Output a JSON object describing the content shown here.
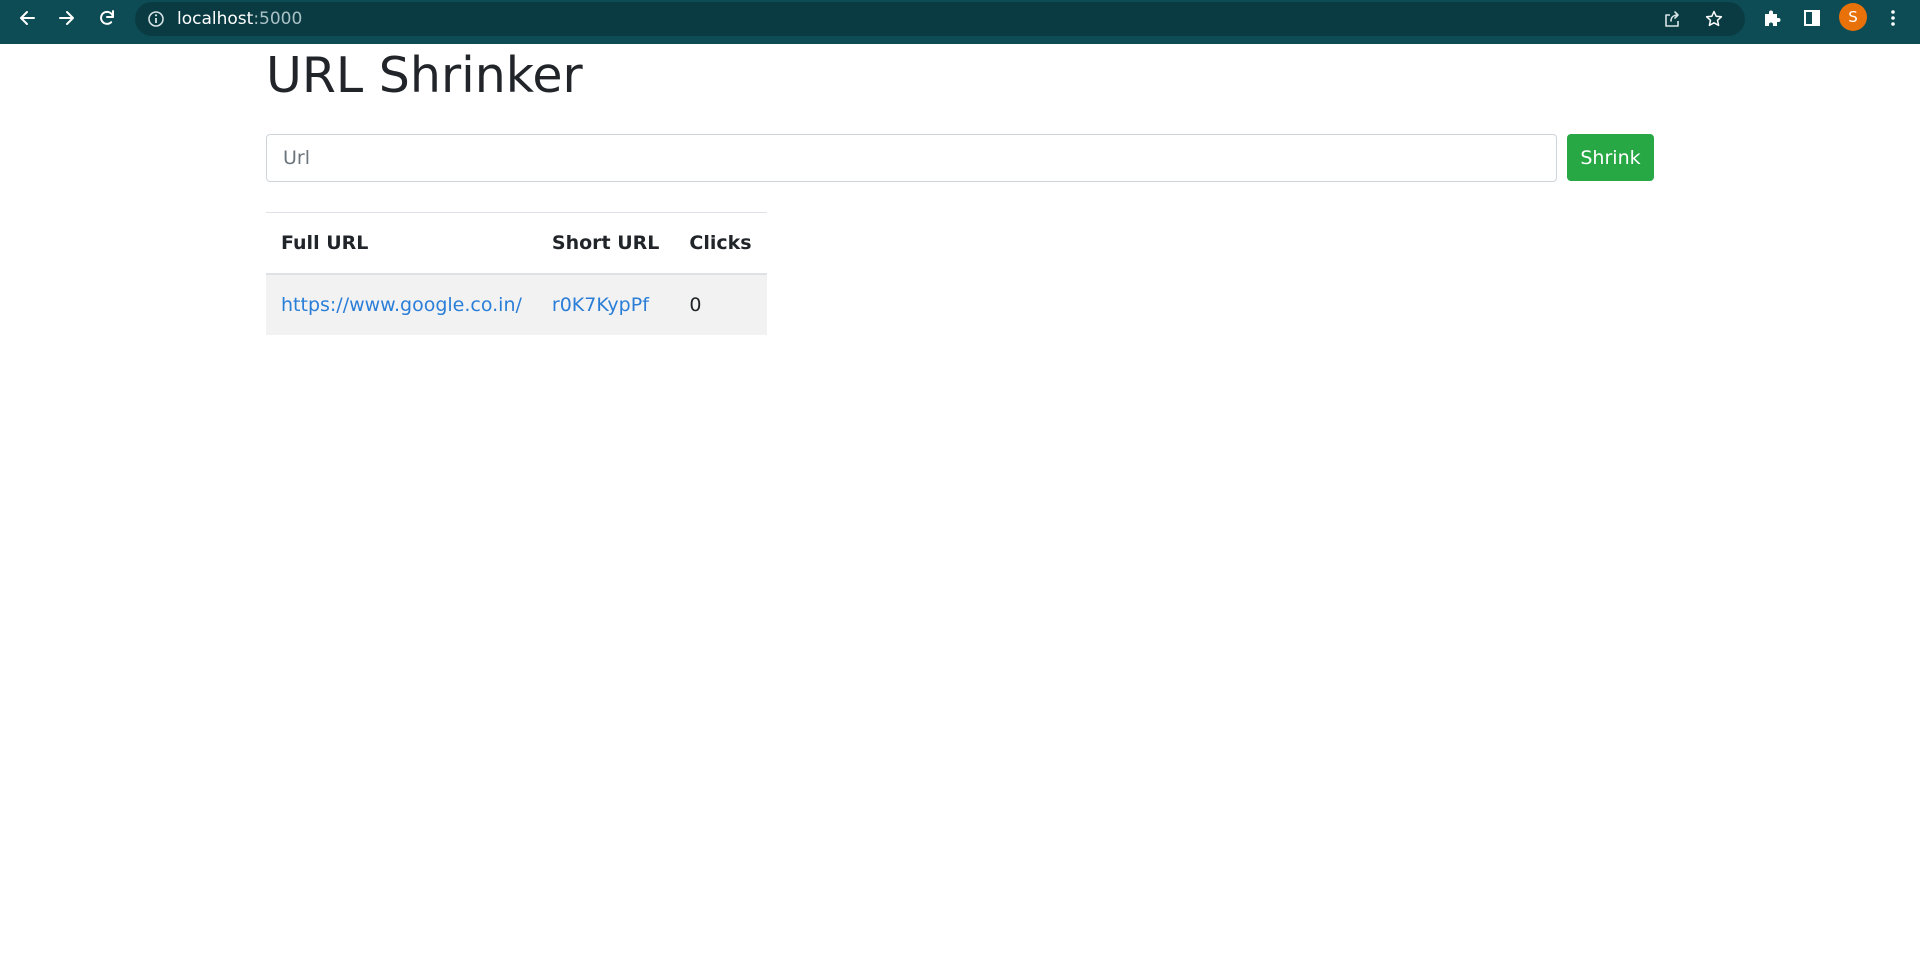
{
  "browser": {
    "url_host": "localhost",
    "url_port": ":5000",
    "profile_initial": "S",
    "icons": {
      "back": "arrow-left-icon",
      "forward": "arrow-right-icon",
      "reload": "reload-icon",
      "site_info": "info-icon",
      "share": "share-icon",
      "bookmark": "star-icon",
      "extensions": "puzzle-icon",
      "side_panel": "side-panel-icon",
      "menu": "kebab-menu-icon"
    },
    "colors": {
      "toolbar": "#0d4b55",
      "omnibox": "#0a3b43",
      "avatar": "#e8710a"
    }
  },
  "page": {
    "title": "URL Shrinker",
    "form": {
      "input_value": "",
      "input_placeholder": "Url",
      "submit_label": "Shrink"
    },
    "table": {
      "headers": [
        "Full URL",
        "Short URL",
        "Clicks"
      ],
      "rows": [
        {
          "full_url": "https://www.google.co.in/",
          "short_url": "r0K7KypPf",
          "clicks": "0"
        }
      ]
    },
    "colors": {
      "accent_button": "#28a745",
      "link": "#2a7ed8",
      "row_stripe": "#f2f2f2"
    }
  }
}
